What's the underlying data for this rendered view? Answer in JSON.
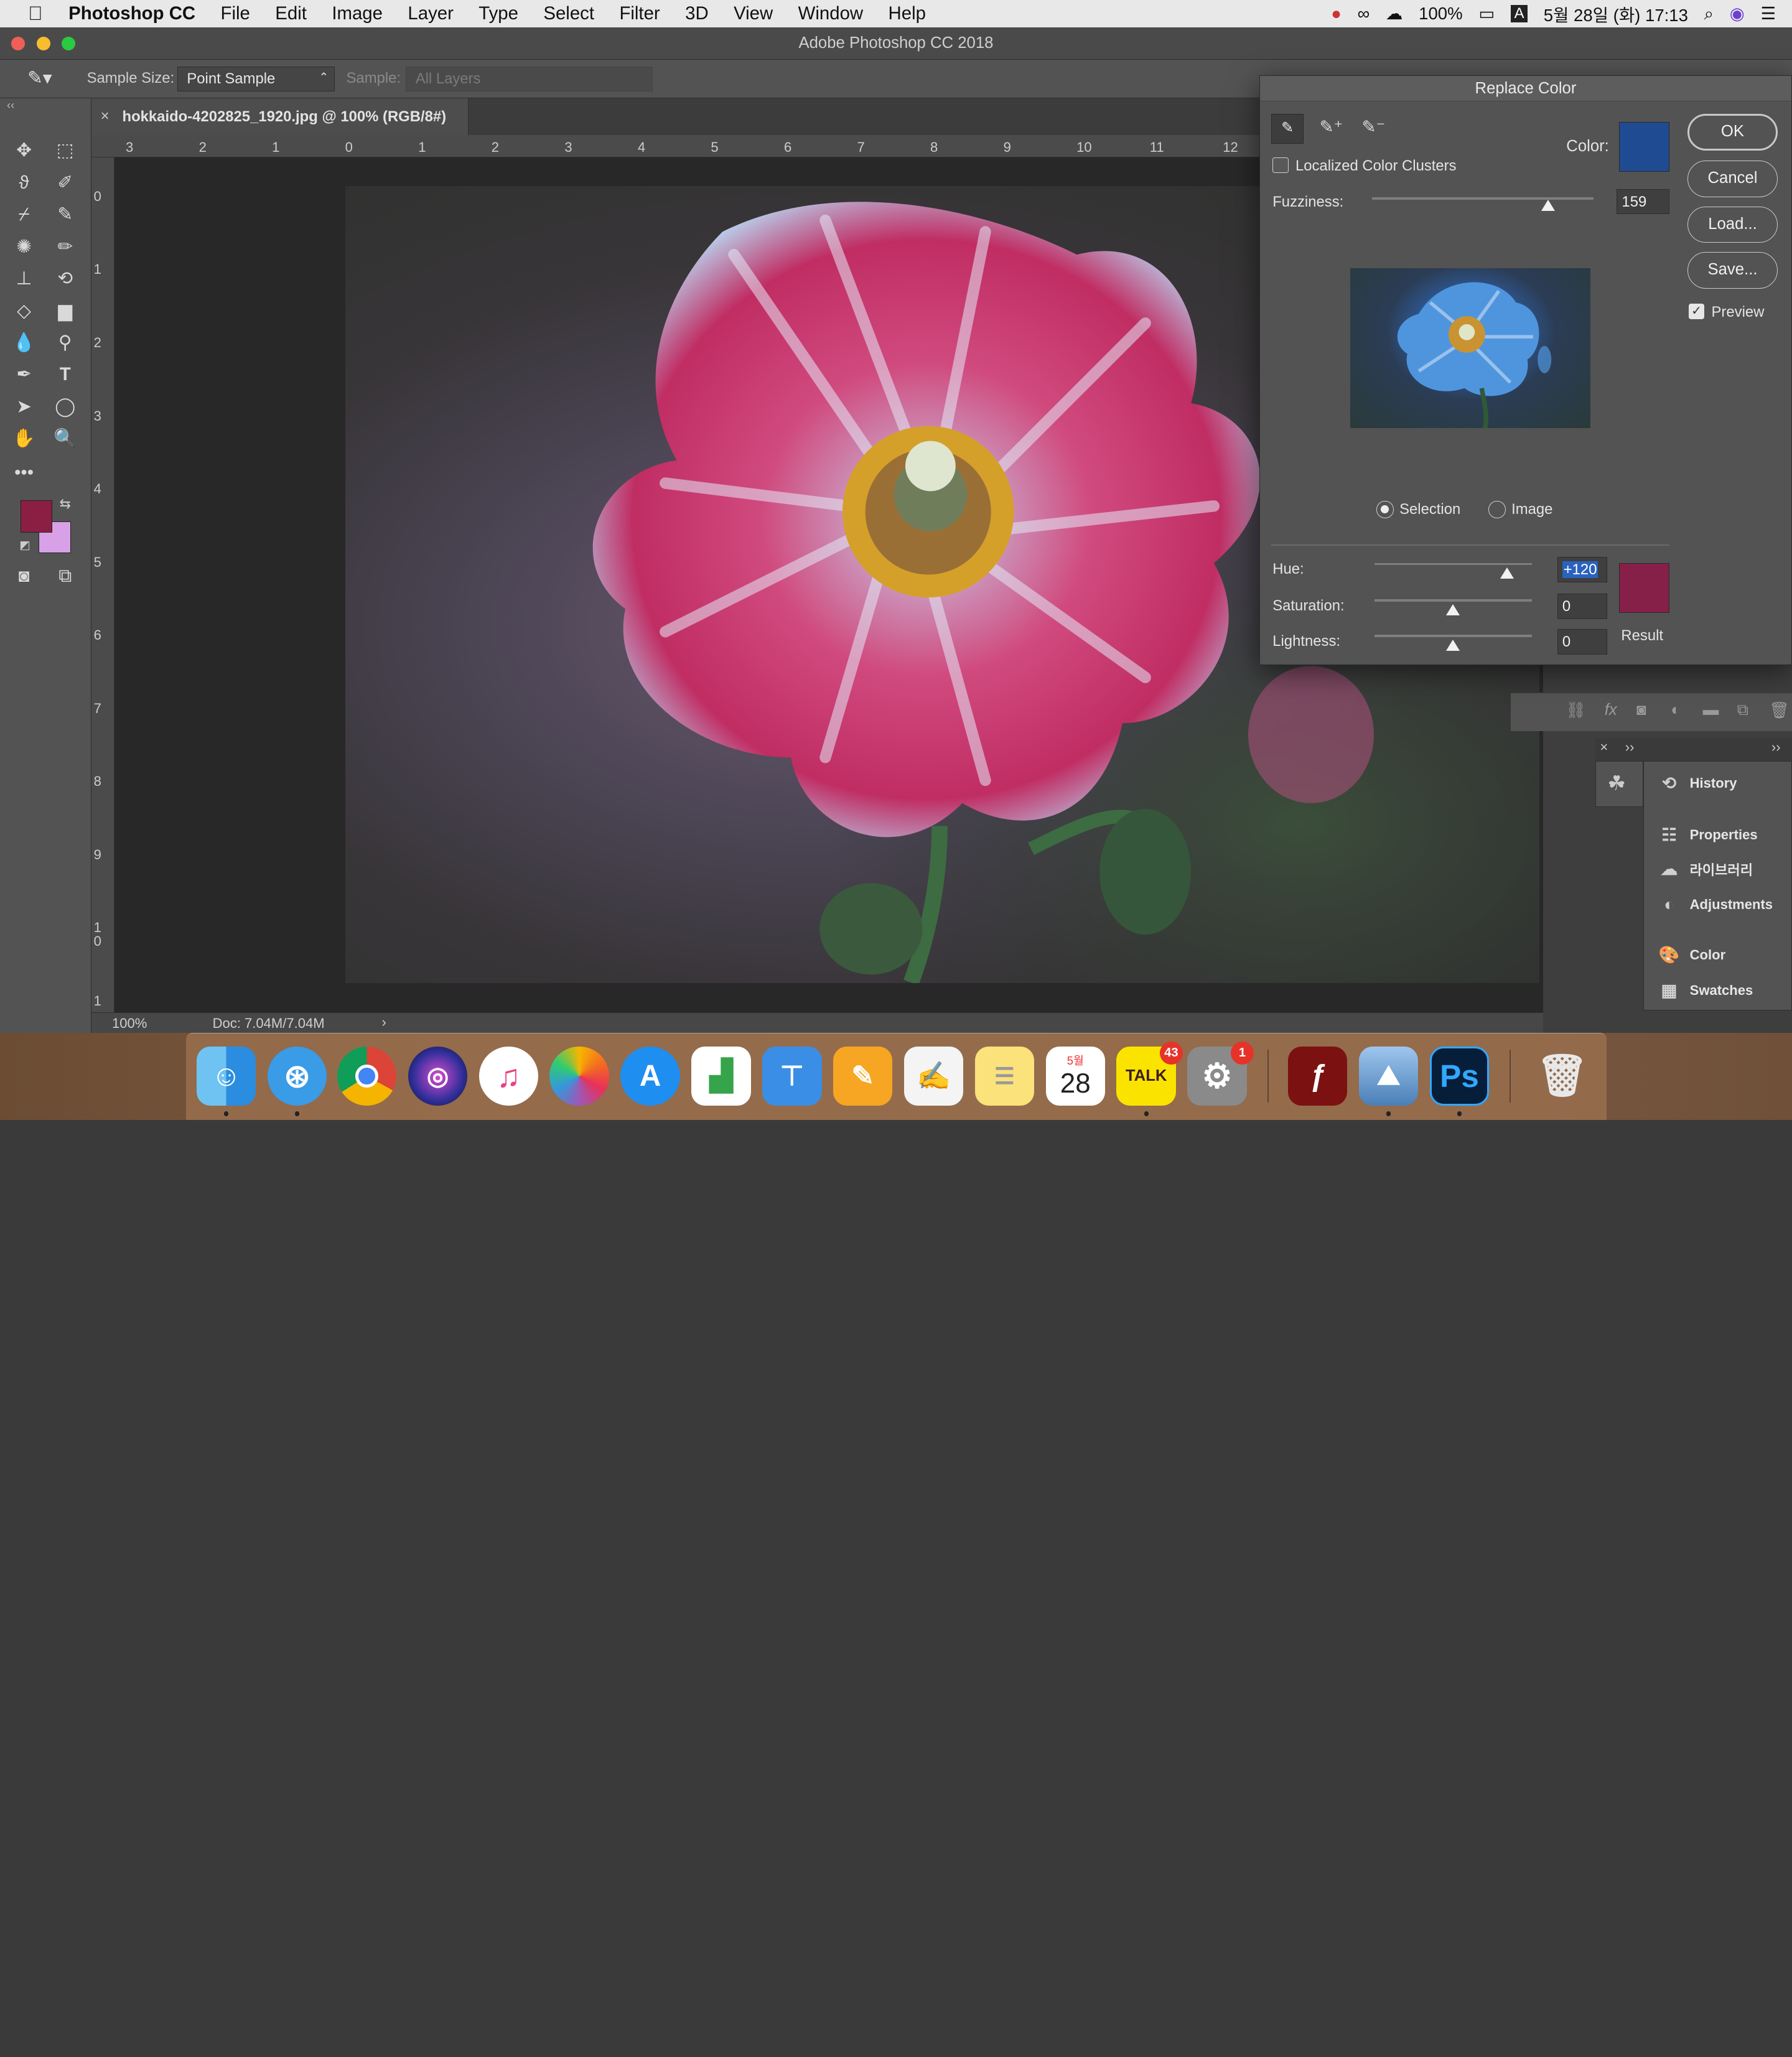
{
  "menubar": {
    "app_name": "Photoshop CC",
    "items": [
      "File",
      "Edit",
      "Image",
      "Layer",
      "Type",
      "Select",
      "Filter",
      "3D",
      "View",
      "Window",
      "Help"
    ],
    "battery": "100%",
    "input_method": "A",
    "datetime": "5월 28일 (화)  17:13"
  },
  "window": {
    "title": "Adobe Photoshop CC 2018"
  },
  "options": {
    "sample_size_label": "Sample Size:",
    "sample_size_value": "Point Sample",
    "sample_label": "Sample:",
    "sample_value": "All Layers"
  },
  "document": {
    "tab_close": "×",
    "tab_title": "hokkaido-4202825_1920.jpg @ 100% (RGB/8#)",
    "zoom": "100%",
    "doc_info": "Doc: 7.04M/7.04M",
    "ruler_h": [
      "3",
      "2",
      "1",
      "0",
      "1",
      "2",
      "3",
      "4",
      "5",
      "6",
      "7",
      "8",
      "9",
      "10",
      "11",
      "12"
    ],
    "ruler_v": [
      "0",
      "1",
      "2",
      "3",
      "4",
      "5",
      "6",
      "7",
      "8",
      "9",
      "1 0",
      "1"
    ]
  },
  "colors": {
    "foreground": "#8b1f43",
    "background": "#d8a0e6",
    "dialog_color": "#1f4b93",
    "result": "#862048"
  },
  "dialog": {
    "title": "Replace Color",
    "color_label": "Color:",
    "localized_label": "Localized Color Clusters",
    "localized_checked": false,
    "fuzziness_label": "Fuzziness:",
    "fuzziness_value": "159",
    "selection_label": "Selection",
    "image_label": "Image",
    "selected_mode": "Selection",
    "hue_label": "Hue:",
    "hue_value": "+120",
    "saturation_label": "Saturation:",
    "saturation_value": "0",
    "lightness_label": "Lightness:",
    "lightness_value": "0",
    "result_label": "Result",
    "ok_label": "OK",
    "cancel_label": "Cancel",
    "load_label": "Load...",
    "save_label": "Save...",
    "preview_label": "Preview",
    "preview_checked": true
  },
  "panels": {
    "items": [
      {
        "label": "History",
        "icon": "history-icon"
      },
      {
        "label": "Properties",
        "icon": "properties-icon"
      },
      {
        "label": "라이브러리",
        "icon": "libraries-icon"
      },
      {
        "label": "Adjustments",
        "icon": "adjustments-icon"
      },
      {
        "label": "Color",
        "icon": "color-palette-icon"
      },
      {
        "label": "Swatches",
        "icon": "swatches-icon"
      }
    ]
  },
  "dock": {
    "kakaotalk_label": "TALK",
    "kakaotalk_badge": "43",
    "preferences_badge": "1",
    "calendar_month": "5월",
    "calendar_day": "28",
    "photoshop_label": "Ps"
  }
}
